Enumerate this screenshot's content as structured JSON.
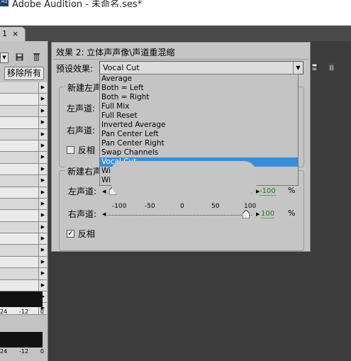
{
  "window": {
    "title": "Adobe Audition - 未命名.ses*",
    "app_icon_text": "Au"
  },
  "tab": {
    "label": "1",
    "close": "×"
  },
  "left_panel": {
    "remove_all_label": "移除所有",
    "row_count": 20,
    "meter_scale": [
      "24",
      "-12",
      "0"
    ]
  },
  "effect": {
    "title": "效果 2: 立体声声像\\声道重混缩",
    "preset_label": "预设效果:",
    "preset_value": "Vocal Cut",
    "left_group": {
      "title": "新建左声道",
      "left_label": "左声道:",
      "right_label": "右声道:",
      "invert_label": "反相",
      "invert_checked": false
    },
    "right_group": {
      "title": "新建右声道",
      "left_label": "左声道:",
      "right_label": "右声道:",
      "invert_label": "反相",
      "invert_checked": true,
      "left_value": "-100",
      "right_value": "100",
      "unit": "%",
      "ticks": [
        "-100",
        "-50",
        "0",
        "50",
        "100"
      ]
    }
  },
  "dropdown": {
    "items": [
      "Average",
      "Both = Left",
      "Both = Right",
      "Full Mix",
      "Full Reset",
      "Inverted Average",
      "Pan Center Left",
      "Pan Center Right",
      "Swap Channels",
      "Vocal Cut",
      "Wi",
      "Wi"
    ],
    "selected_index": 9
  }
}
